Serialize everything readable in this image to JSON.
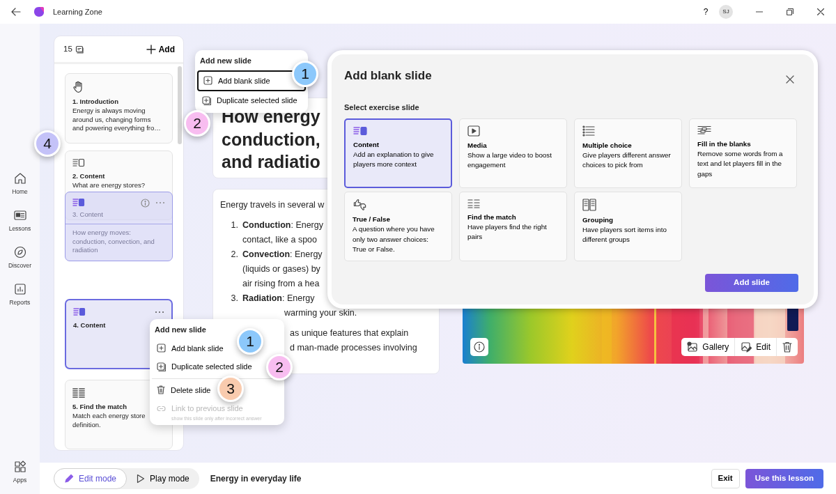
{
  "title_bar": {
    "title": "Learning Zone",
    "help": "?",
    "avatar": "SJ"
  },
  "nav": [
    {
      "kind": "home",
      "label": "Home",
      "selected": false
    },
    {
      "kind": "lessons",
      "label": "Lessons",
      "selected": false
    },
    {
      "kind": "discover",
      "label": "Discover",
      "selected": false
    },
    {
      "kind": "reports",
      "label": "Reports",
      "selected": false
    }
  ],
  "apps": {
    "label": "Apps"
  },
  "slide_panel": {
    "count": "15",
    "add": "Add",
    "slides": [
      {
        "kind": "intro",
        "title": "1. Introduction",
        "lines": [
          "Energy is always moving",
          "around us, changing forms",
          "and powering everything fro…"
        ],
        "selected": false,
        "dragging": false
      },
      {
        "kind": "content",
        "title": "2. Content",
        "lines": [
          "What are energy stores?"
        ],
        "selected": false,
        "dragging": false
      },
      {
        "kind": "content",
        "title": "3. Content",
        "lines": [
          "How energy moves:",
          "conduction, convection, and",
          "radiation"
        ],
        "selected": false,
        "dragging": true
      },
      {
        "kind": "content",
        "title": "4. Content",
        "selected": true,
        "dragging": false
      },
      {
        "kind": "match",
        "title": "5. Find the match",
        "lines": [
          "Match each energy store",
          "definition."
        ],
        "selected": false,
        "dragging": false
      }
    ]
  },
  "title_card": {
    "lines": [
      "How energy",
      "conduction,",
      "and radiatio"
    ]
  },
  "body_card": {
    "intro": "Energy travels in several w",
    "items": [
      {
        "number": "1.",
        "lines": [
          "**Conduction**: Energy",
          "contact, like a spoo"
        ]
      },
      {
        "number": "2.",
        "lines": [
          "**Convection**: Energy",
          "(liquids or gases) by",
          "air rising from a hea"
        ]
      },
      {
        "number": "3.",
        "lines": [
          "**Radiation**: Energy",
          "warming your skin."
        ]
      }
    ],
    "outro": [
      "as unique features that explain",
      "d man-made processes involving"
    ]
  },
  "media": {
    "kind": "picture",
    "gallery": "Gallery",
    "edit": "Edit"
  },
  "top_menu": {
    "heading": "Add new slide",
    "items": [
      {
        "kind": "add",
        "label": "Add blank slide",
        "focused": true
      },
      {
        "kind": "duplicate",
        "label": "Duplicate selected slide",
        "focused": false
      }
    ]
  },
  "context_menu": {
    "heading": "Add new slide",
    "items": [
      {
        "kind": "add",
        "label": "Add blank slide",
        "disabled": false
      },
      {
        "kind": "duplicate",
        "label": "Duplicate selected slide",
        "disabled": false
      },
      {
        "kind": "delete",
        "label": "Delete slide",
        "disabled": false
      },
      {
        "kind": "link",
        "label": "Link to previous slide",
        "hint": "show this slide only after incorrect answer",
        "disabled": true
      }
    ]
  },
  "dialog": {
    "title": "Add blank slide",
    "subtitle": "Select exercise slide",
    "options": [
      {
        "kind": "content",
        "title": "Content",
        "text": "Add an explanation to give players more context",
        "selected": true
      },
      {
        "kind": "media",
        "title": "Media",
        "text": "Show a large video to boost engagement",
        "selected": false
      },
      {
        "kind": "choice",
        "title": "Multiple choice",
        "text": "Give players different answer choices to pick from",
        "selected": false
      },
      {
        "kind": "blanks",
        "title": "Fill in the blanks",
        "text": "Remove some words from a text and let players fill in the gaps",
        "selected": false
      },
      {
        "kind": "truefalse",
        "title": "True / False",
        "text": "A question where you have only two answer choices: True or False.",
        "selected": false
      },
      {
        "kind": "match",
        "title": "Find the match",
        "text": "Have players find the right pairs",
        "selected": false
      },
      {
        "kind": "grouping",
        "title": "Grouping",
        "text": "Have players sort items into different groups",
        "selected": false
      }
    ],
    "button": "Add slide"
  },
  "callouts": [
    {
      "number": "1",
      "color": "#8cc8fb"
    },
    {
      "number": "2",
      "color": "#f8bdf0"
    },
    {
      "number": "4",
      "color": "#c4c2f8"
    },
    {
      "number": "1",
      "color": "#8cc8fb"
    },
    {
      "number": "2",
      "color": "#f8bdf0"
    },
    {
      "number": "3",
      "color": "#f9cbae"
    }
  ],
  "bottom_bar": {
    "modes": [
      {
        "kind": "edit",
        "label": "Edit mode",
        "selected": true
      },
      {
        "kind": "play",
        "label": "Play mode",
        "selected": false
      }
    ],
    "lesson": "Energy in everyday life",
    "exit": "Exit",
    "use": "Use this lesson"
  }
}
